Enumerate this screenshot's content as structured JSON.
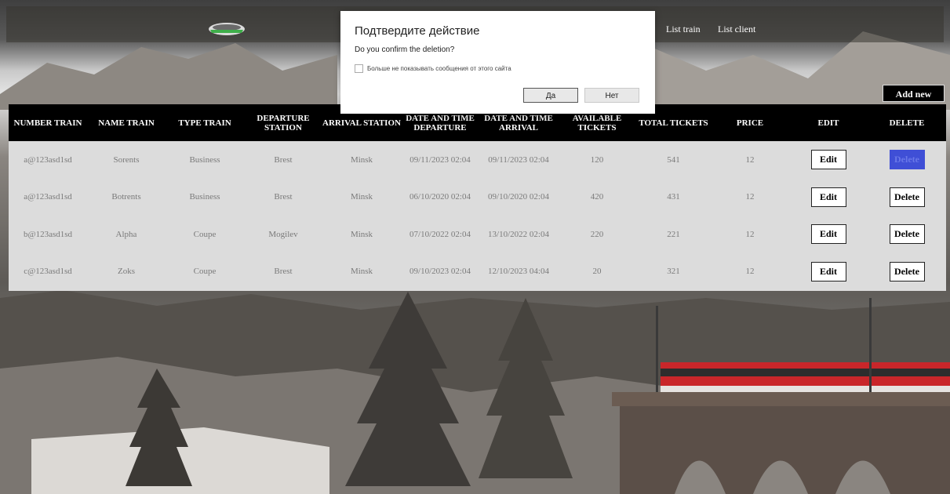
{
  "nav": {
    "list_train": "List train",
    "list_client": "List client"
  },
  "add_button": "Add new train",
  "table": {
    "headers": [
      "NUMBER TRAIN",
      "NAME TRAIN",
      "TYPE TRAIN",
      "DEPARTURE STATION",
      "ARRIVAL STATION",
      "DATE AND TIME DEPARTURE",
      "DATE AND TIME ARRIVAL",
      "AVAILABLE TICKETS",
      "TOTAL TICKETS",
      "PRICE",
      "EDIT",
      "DELETE"
    ],
    "rows": [
      [
        "a@123asd1sd",
        "Sorents",
        "Business",
        "Brest",
        "Minsk",
        "09/11/2023 02:04",
        "09/11/2023 02:04",
        "120",
        "541",
        "12"
      ],
      [
        "a@123asd1sd",
        "Botrents",
        "Business",
        "Brest",
        "Minsk",
        "06/10/2020 02:04",
        "09/10/2020 02:04",
        "420",
        "431",
        "12"
      ],
      [
        "b@123asd1sd",
        "Alpha",
        "Coupe",
        "Mogilev",
        "Minsk",
        "07/10/2022 02:04",
        "13/10/2022 02:04",
        "220",
        "221",
        "12"
      ],
      [
        "c@123asd1sd",
        "Zoks",
        "Coupe",
        "Brest",
        "Minsk",
        "09/10/2023 02:04",
        "12/10/2023 04:04",
        "20",
        "321",
        "12"
      ]
    ],
    "edit_label": "Edit",
    "delete_label": "Delete"
  },
  "dialog": {
    "title": "Подтвердите действие",
    "message": "Do you confirm the deletion?",
    "checkbox_label": "Больше не показывать сообщения от этого сайта",
    "ok_label": "Да",
    "cancel_label": "Нет"
  },
  "colors": {
    "header_bg": "#000000",
    "active_delete": "#3f4fd6",
    "table_bg": "#dcdcdc"
  },
  "icons": {
    "logo": "train-logo-icon"
  }
}
